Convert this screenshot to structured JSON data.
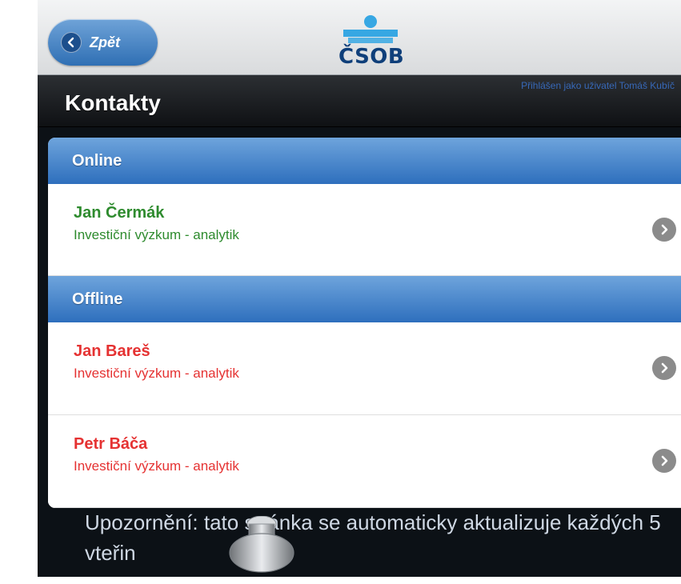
{
  "header": {
    "back_label": "Zpět",
    "logo_text": "ČSOB",
    "title": "Kontakty",
    "login_info": "Přihlášen jako uživatel Tomáš Kubíč"
  },
  "sections": [
    {
      "label": "Online",
      "contacts": [
        {
          "name": "Jan Čermák",
          "role": "Investiční výzkum - analytik",
          "status_color": "#2e8b2e"
        }
      ]
    },
    {
      "label": "Offline",
      "contacts": [
        {
          "name": "Jan Bareš",
          "role": "Investiční výzkum - analytik",
          "status_color": "#e53232"
        },
        {
          "name": "Petr Báča",
          "role": "Investiční výzkum - analytik",
          "status_color": "#e53232"
        }
      ]
    }
  ],
  "notice": "Upozornění: tato stránka se automaticky aktualizuje každých 5 vteřin",
  "icons": {
    "back": "back-arrow-icon",
    "row_arrow": "chevron-right-icon",
    "logo": "bank-logo-icon"
  },
  "colors": {
    "accent_blue": "#2e6fbd",
    "online": "#2e8b2e",
    "offline": "#e53232"
  }
}
